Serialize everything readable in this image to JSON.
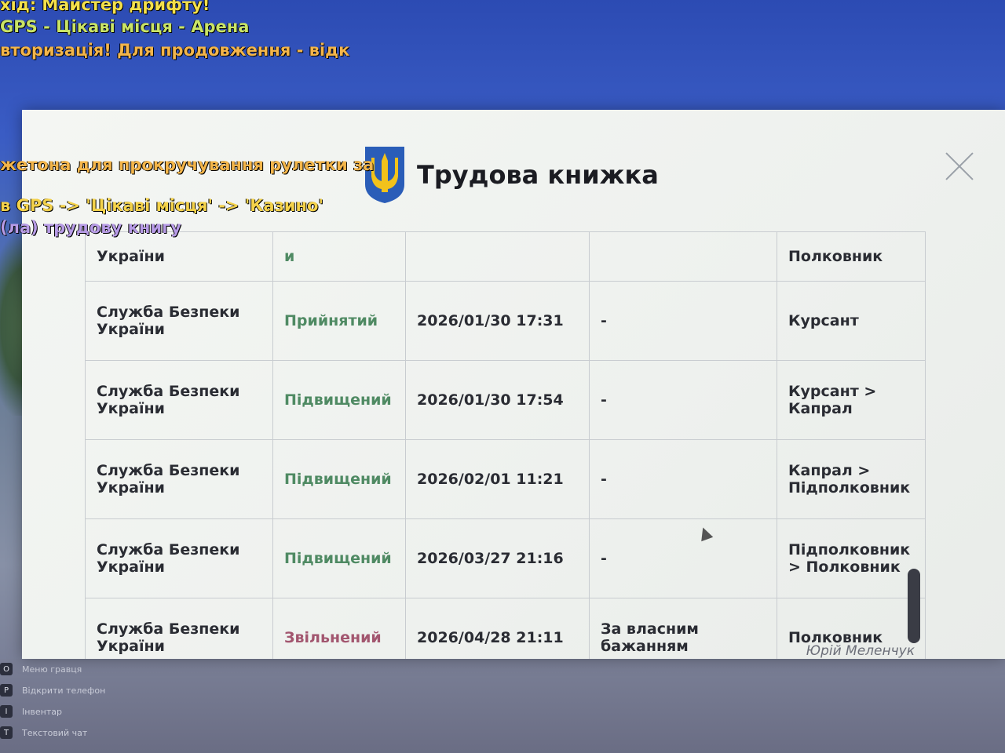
{
  "chat": {
    "lines": [
      {
        "text": "хід: Майстер дрифту!",
        "color": "#f4e04a"
      },
      {
        "text": "GPS - Цікаві місця - Арена",
        "color": "#c9e466"
      },
      {
        "text": "вторизація! Для продовження - відк",
        "color": "#f3b54a"
      },
      {
        "text": "жетона для прокручування рулетки за",
        "color": "#f3b54a"
      },
      {
        "text": "в GPS -> 'Цікаві місця' -> 'Казино'",
        "color": "#f4d24a"
      },
      {
        "text": "(ла) трудову книгу",
        "color": "#b79be6"
      }
    ]
  },
  "hints": [
    {
      "key": "О",
      "label": "Меню гравця"
    },
    {
      "key": "P",
      "label": "Відкрити телефон"
    },
    {
      "key": "I",
      "label": "Інвентар"
    },
    {
      "key": "T",
      "label": "Текстовий чат"
    }
  ],
  "window": {
    "title": "Трудова книжка",
    "close_icon": "close-icon",
    "emblem_icon": "trident-emblem-icon"
  },
  "table": {
    "partial_row": {
      "org": "України",
      "status": "и",
      "date": "",
      "reason": "",
      "rank": "Полковник"
    },
    "rows": [
      {
        "org": "Служба Безпеки України",
        "status": "Прийнятий",
        "status_type": "green",
        "date": "2026/01/30 17:31",
        "reason": "-",
        "rank": "Курсант"
      },
      {
        "org": "Служба Безпеки України",
        "status": "Підвищений",
        "status_type": "green",
        "date": "2026/01/30 17:54",
        "reason": "-",
        "rank": "Курсант > Капрал"
      },
      {
        "org": "Служба Безпеки України",
        "status": "Підвищений",
        "status_type": "green",
        "date": "2026/02/01 11:21",
        "reason": "-",
        "rank": "Капрал > Підполковник"
      },
      {
        "org": "Служба Безпеки України",
        "status": "Підвищений",
        "status_type": "green",
        "date": "2026/03/27 21:16",
        "reason": "-",
        "rank": "Підполковник > Полковник"
      },
      {
        "org": "Служба Безпеки України",
        "status": "Звільнений",
        "status_type": "red",
        "date": "2026/04/28 21:11",
        "reason": "За власним бажанням",
        "rank": "Полковник"
      }
    ]
  },
  "signature": "Юрій Меленчук",
  "colors": {
    "status_green": "#4f8a63",
    "status_red": "#a2566f",
    "emblem_blue": "#2a5db8",
    "emblem_gold": "#f2c21b"
  }
}
